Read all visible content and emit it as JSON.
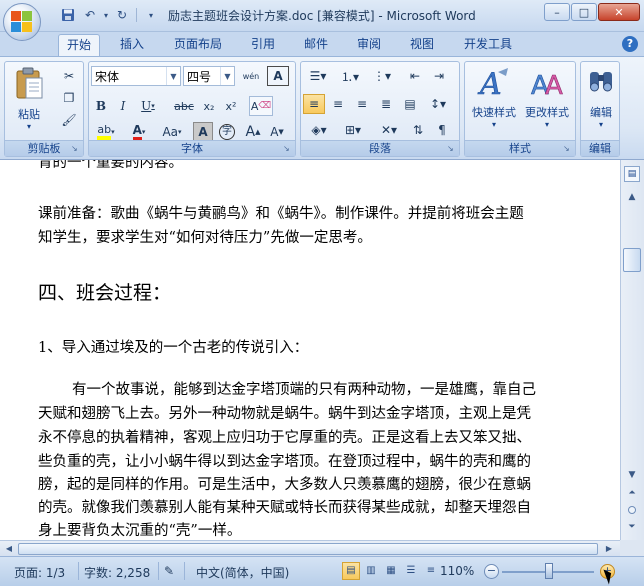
{
  "window": {
    "title": "励志主题班会设计方案.doc [兼容模式] - Microsoft Word",
    "minimize": "–",
    "maximize": "□",
    "close": "✕"
  },
  "tabs": [
    "开始",
    "插入",
    "页面布局",
    "引用",
    "邮件",
    "审阅",
    "视图",
    "开发工具"
  ],
  "active_tab": "开始",
  "ribbon": {
    "clipboard": {
      "label": "剪贴板",
      "paste": "粘贴"
    },
    "font": {
      "label": "字体",
      "font_name": "宋体",
      "font_size": "四号",
      "bold": "B",
      "italic": "I",
      "underline": "U",
      "strike": "abc",
      "subscript": "x₂",
      "superscript": "x²",
      "grow": "A",
      "shrink": "A",
      "case": "Aa",
      "char_border": "A",
      "enclose": "字",
      "phonetic": "wén",
      "clear": "A"
    },
    "paragraph": {
      "label": "段落"
    },
    "styles": {
      "label": "样式",
      "quick_styles": "快速样式",
      "change_styles": "更改样式"
    },
    "editing": {
      "label": "编辑",
      "edit": "编辑"
    }
  },
  "document": {
    "lines": [
      "育的一个重要的内容。",
      "课前准备：歌曲《蜗牛与黄鹂鸟》和《蜗牛》。制作课件。并提前将班会主题",
      "知学生，要求学生对“如何对待压力”先做一定思考。",
      "四、班会过程：",
      "1、导入通过埃及的一个古老的传说引入：",
      "有一个故事说，能够到达金字塔顶端的只有两种动物，一是雄鹰，靠自己",
      "天赋和翅膀飞上去。另外一种动物就是蜗牛。蜗牛到达金字塔顶，主观上是凭",
      "永不停息的执着精神，客观上应归功于它厚重的壳。正是这看上去又笨又拙、",
      "些负重的壳，让小小蜗牛得以到达金字塔顶。在登顶过程中，蜗牛的壳和鹰的",
      "膀，起的是同样的作用。可是生活中，大多数人只羡慕鹰的翅膀，很少在意蜗",
      "的壳。就像我们羡慕别人能有某种天赋或特长而获得某些成就，却整天埋怨自",
      "身上要背负太沉重的“壳”一样。"
    ]
  },
  "status": {
    "page": "页面: 1/3",
    "words": "字数: 2,258",
    "language": "中文(简体，中国)",
    "zoom": "110%",
    "zoom_minus": "−",
    "zoom_plus": "+"
  }
}
